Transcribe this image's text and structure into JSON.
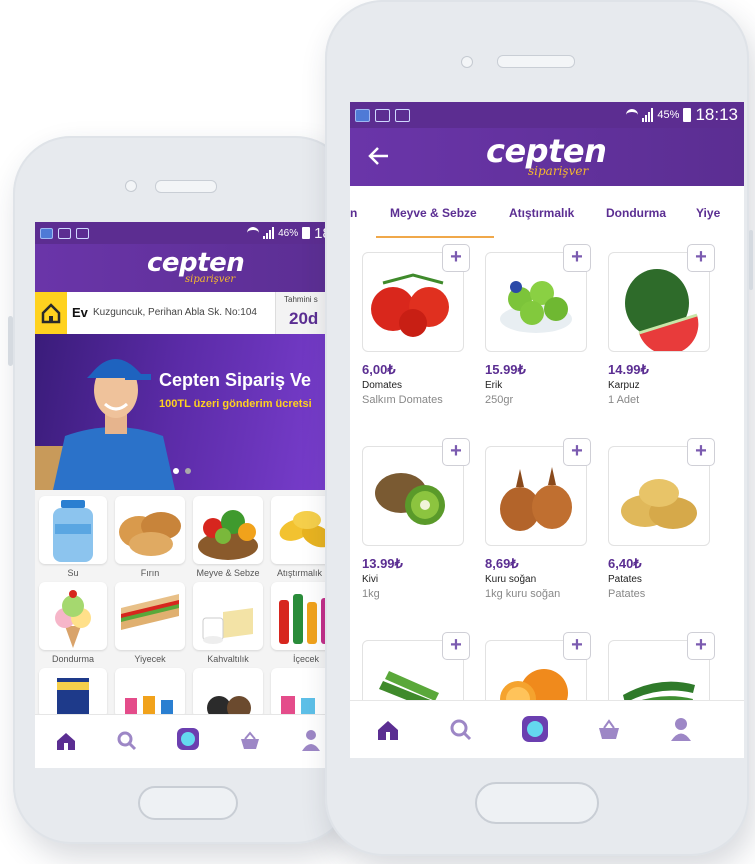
{
  "left_phone": {
    "status": {
      "battery": "46%",
      "time": "18:"
    },
    "logo": {
      "main": "cepten",
      "sub": "siparişver"
    },
    "address": {
      "label": "Ev",
      "text": "Kuzguncuk, Perihan Abla Sk. No:104",
      "estimate_label": "Tahmini s",
      "estimate_value": "20d"
    },
    "banner": {
      "title": "Cepten Sipariş Ve",
      "subtitle": "100TL üzeri gönderim ücretsi"
    },
    "categories": [
      {
        "label": "Su",
        "icon": "water-bottle-icon"
      },
      {
        "label": "Fırın",
        "icon": "bread-icon"
      },
      {
        "label": "Meyve & Sebze",
        "icon": "vegetable-basket-icon"
      },
      {
        "label": "Atıştırmalık",
        "icon": "chips-icon"
      },
      {
        "label": "Dondurma",
        "icon": "ice-cream-icon"
      },
      {
        "label": "Yiyecek",
        "icon": "sandwich-icon"
      },
      {
        "label": "Kahvaltılık",
        "icon": "dairy-icon"
      },
      {
        "label": "İçecek",
        "icon": "drinks-icon"
      }
    ]
  },
  "right_phone": {
    "status": {
      "battery": "45%",
      "time": "18:13"
    },
    "logo": {
      "main": "cepten",
      "sub": "siparişver"
    },
    "tabs": [
      {
        "label": "n"
      },
      {
        "label": "Meyve & Sebze",
        "active": true
      },
      {
        "label": "Atıştırmalık"
      },
      {
        "label": "Dondurma"
      },
      {
        "label": "Yiye"
      }
    ],
    "products": [
      {
        "price": "6,00₺",
        "name": "Domates",
        "desc": "Salkım Domates",
        "icon": "tomato-icon"
      },
      {
        "price": "15.99₺",
        "name": "Erik",
        "desc": "250gr",
        "icon": "plum-icon"
      },
      {
        "price": "14.99₺",
        "name": "Karpuz",
        "desc": "1 Adet",
        "icon": "watermelon-icon"
      },
      {
        "price": "13.99₺",
        "name": "Kivi",
        "desc": "1kg",
        "icon": "kiwi-icon"
      },
      {
        "price": "8,69₺",
        "name": "Kuru soğan",
        "desc": "1kg kuru soğan",
        "icon": "onion-icon"
      },
      {
        "price": "6,40₺",
        "name": "Patates",
        "desc": "Patates",
        "icon": "potato-icon"
      },
      {
        "icon": "leek-icon"
      },
      {
        "icon": "orange-icon"
      },
      {
        "icon": "cucumber-icon"
      }
    ]
  },
  "colors": {
    "brand_purple": "#5b2e92",
    "accent_yellow": "#f5b82e",
    "active_tab_underline": "#f0a84a"
  }
}
